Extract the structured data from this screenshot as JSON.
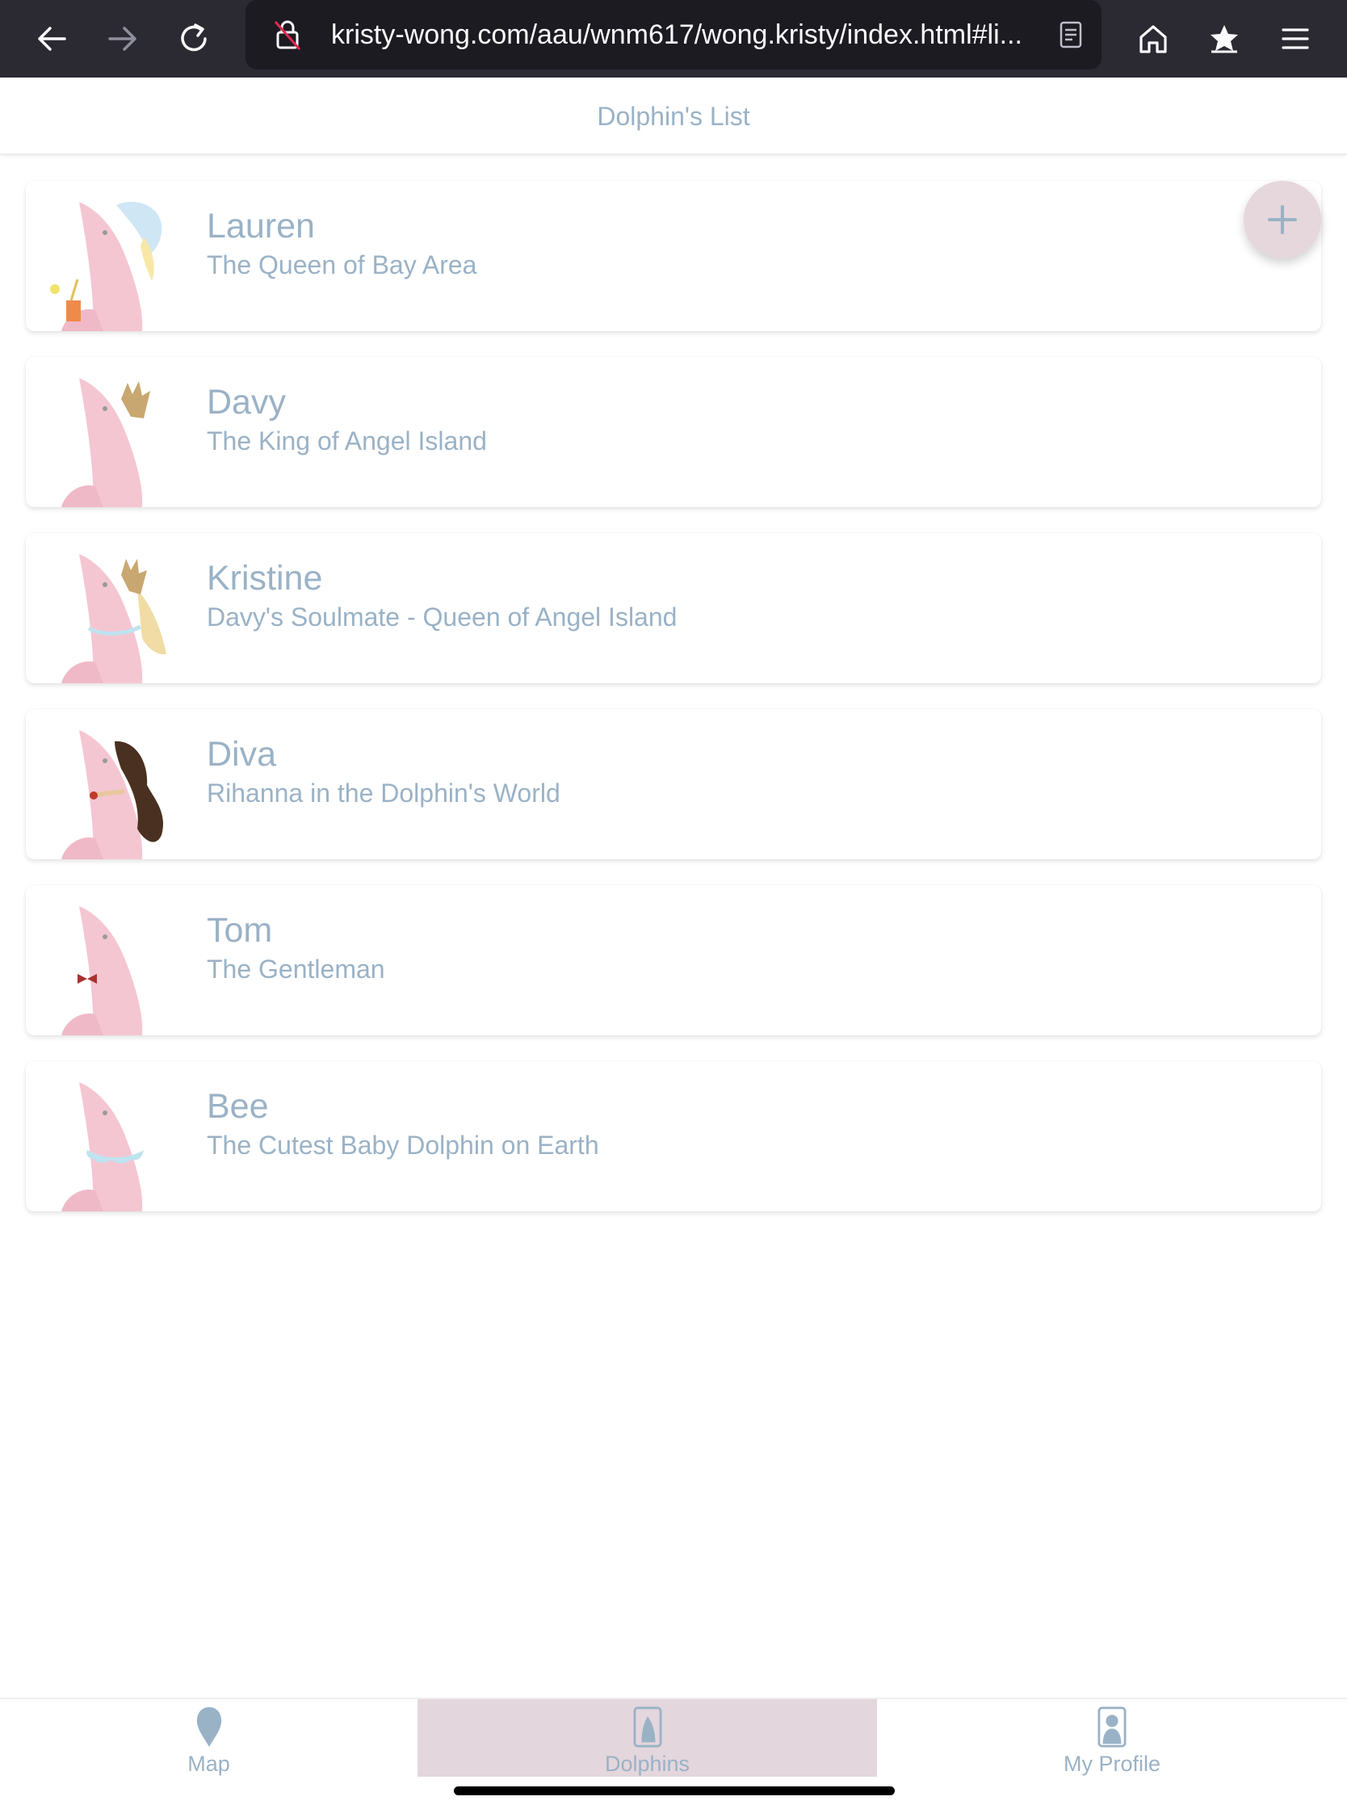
{
  "browser": {
    "url": "kristy-wong.com/aau/wnm617/wong.kristy/index.html#li..."
  },
  "header": {
    "title": "Dolphin's List"
  },
  "dolphins": [
    {
      "name": "Lauren",
      "subtitle": "The Queen of Bay Area",
      "accessory": "sunhat-and-drink"
    },
    {
      "name": "Davy",
      "subtitle": "The King of Angel Island",
      "accessory": "crown"
    },
    {
      "name": "Kristine",
      "subtitle": "Davy's Soulmate - Queen of Angel Island",
      "accessory": "crown-and-hair"
    },
    {
      "name": "Diva",
      "subtitle": "Rihanna in the Dolphin's World",
      "accessory": "dark-hair"
    },
    {
      "name": "Tom",
      "subtitle": "The Gentleman",
      "accessory": "bow-tie"
    },
    {
      "name": "Bee",
      "subtitle": "The Cutest Baby Dolphin on Earth",
      "accessory": "collar"
    }
  ],
  "fab": {
    "icon": "plus-icon"
  },
  "nav": {
    "items": [
      {
        "label": "Map",
        "icon": "map-pin-icon",
        "active": false
      },
      {
        "label": "Dolphins",
        "icon": "dolphin-card-icon",
        "active": true
      },
      {
        "label": "My Profile",
        "icon": "profile-card-icon",
        "active": false
      }
    ]
  },
  "colors": {
    "accent_text": "#9ab2c6",
    "dolphin_pink": "#f4c6d2",
    "active_nav": "#e3d6dc",
    "toolbar": "#2b2a33"
  }
}
